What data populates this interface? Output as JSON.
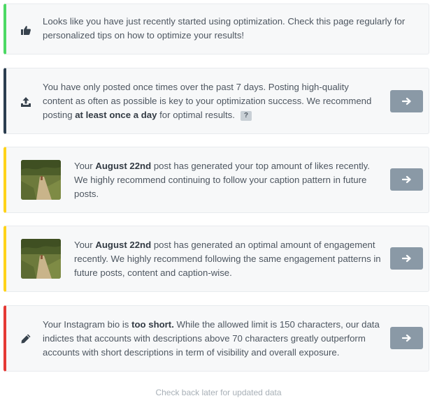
{
  "colors": {
    "green": "#4cd964",
    "navy": "#2c3e50",
    "yellow": "#ffd31a",
    "red": "#e53935",
    "button": "#8a99a6"
  },
  "tips": [
    {
      "icon": "thumbs-up-icon",
      "text": "Looks like you have just recently started using optimization. Check this page regularly for personalized tips on how to optimize your results!"
    },
    {
      "icon": "upload-icon",
      "text_before": "You have only posted once times over the past 7 days. Posting high-quality content as often as possible is key to your optimization success. We recommend posting ",
      "bold": "at least once a day",
      "text_after": " for optimal results.",
      "help": "?"
    },
    {
      "icon": "post-thumbnail",
      "text_before": "Your ",
      "bold": "August 22nd",
      "text_after": " post has generated your top amount of likes recently. We highly recommend continuing to follow your caption pattern in future posts."
    },
    {
      "icon": "post-thumbnail",
      "text_before": "Your ",
      "bold": "August 22nd",
      "text_after": " post has generated an optimal amount of engagement recently. We highly recommend following the same engagement patterns in future posts, content and caption-wise."
    },
    {
      "icon": "pencil-icon",
      "text_before": "Your Instagram bio is ",
      "bold": "too short.",
      "text_after": " While the allowed limit is 150 characters, our data indictes that accounts with descriptions above 70 characters greatly outperform accounts with short descriptions in term of visibility and overall exposure."
    }
  ],
  "footer": "Check back later for updated data"
}
